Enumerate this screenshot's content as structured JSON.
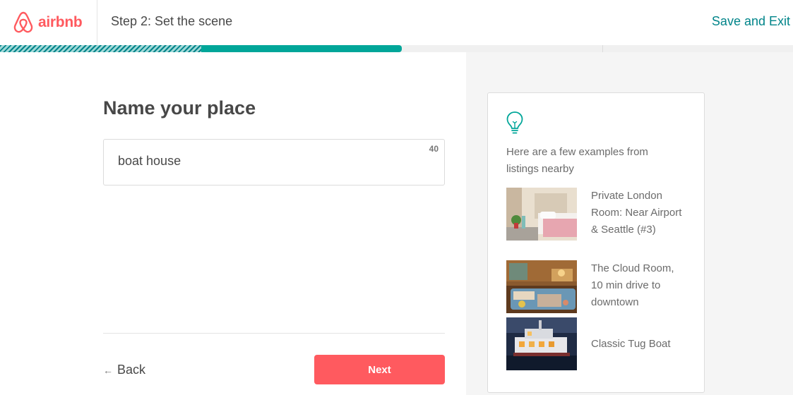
{
  "header": {
    "logo_text": "airbnb",
    "step_title": "Step 2: Set the scene",
    "save_exit_label": "Save and Exit"
  },
  "progress": {
    "completed_fraction": 0.254,
    "current_fraction": 0.507
  },
  "form": {
    "title": "Name your place",
    "name_value": "boat house",
    "char_count": "40",
    "back_label": "Back",
    "next_label": "Next"
  },
  "tips": {
    "icon": "lightbulb-icon",
    "intro": "Here are a few examples from listings nearby",
    "examples": [
      {
        "label": "Private London Room: Near Airport & Seattle (#3)"
      },
      {
        "label": "The Cloud Room, 10 min drive to downtown"
      },
      {
        "label": "Classic Tug Boat"
      }
    ]
  },
  "colors": {
    "brand": "#FF5A5F",
    "accent": "#008489",
    "progress": "#00A699"
  }
}
